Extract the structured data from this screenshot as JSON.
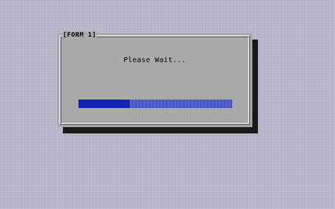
{
  "dialog": {
    "title": "[FORM 1]",
    "message": "Please Wait..."
  },
  "progress": {
    "fraction": 0.33
  },
  "colors": {
    "desktop": "#b9b8cc",
    "dialog_face": "#a9a9a9",
    "shadow": "#1a1a1a",
    "progress_fill": "#1222b4",
    "progress_track": "#4a5ac6"
  }
}
